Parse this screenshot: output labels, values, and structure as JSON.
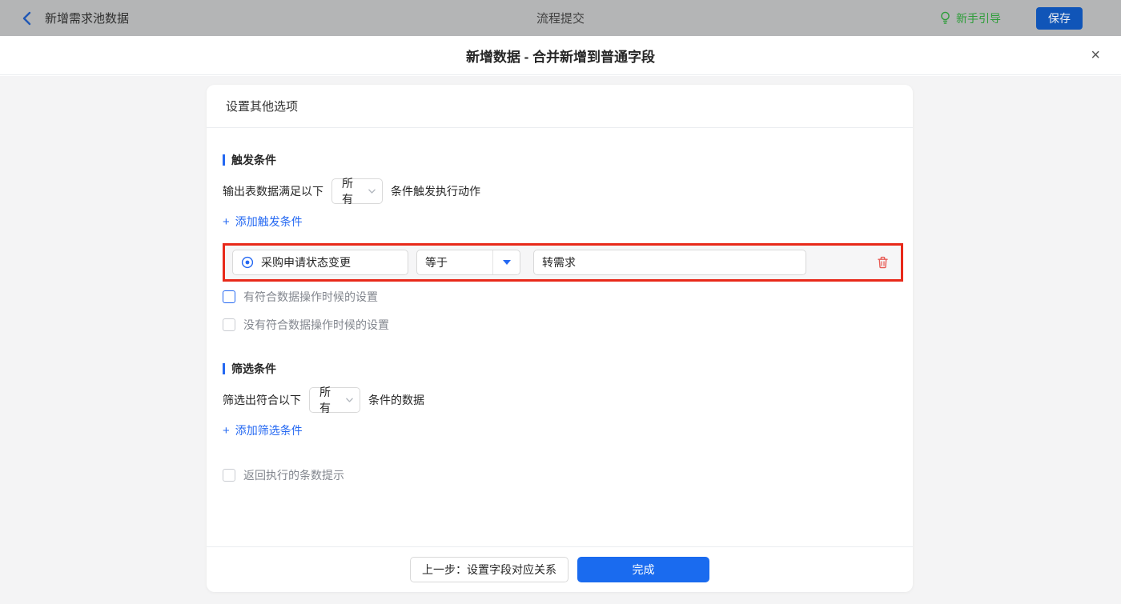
{
  "topbar": {
    "back_label": "新增需求池数据",
    "center_title": "流程提交",
    "guide_label": "新手引导",
    "save_label": "保存"
  },
  "modal": {
    "title": "新增数据 - 合并新增到普通字段",
    "close_glyph": "×"
  },
  "card": {
    "header_title": "设置其他选项",
    "trigger": {
      "section_title": "触发条件",
      "prefix": "输出表数据满足以下",
      "match_value": "所有",
      "suffix": "条件触发执行动作",
      "add_icon": "+",
      "add_label": "添加触发条件",
      "row": {
        "field": "采购申请状态变更",
        "operator": "等于",
        "value": "转需求"
      },
      "checkbox_match": "有符合数据操作时候的设置",
      "checkbox_nomatch": "没有符合数据操作时候的设置"
    },
    "filter": {
      "section_title": "筛选条件",
      "prefix": "筛选出符合以下",
      "match_value": "所有",
      "suffix": "条件的数据",
      "add_icon": "+",
      "add_label": "添加筛选条件",
      "checkbox_tip": "返回执行的条数提示"
    },
    "footer": {
      "prev_label": "上一步：设置字段对应关系",
      "done_label": "完成"
    }
  },
  "colors": {
    "accent_blue": "#1a6bef",
    "link_blue": "#2468f2",
    "highlight_red": "#e8291a",
    "danger_red": "#e85a54",
    "guide_green": "#2e9d3a",
    "topbar_bg": "#b4b5b6"
  }
}
